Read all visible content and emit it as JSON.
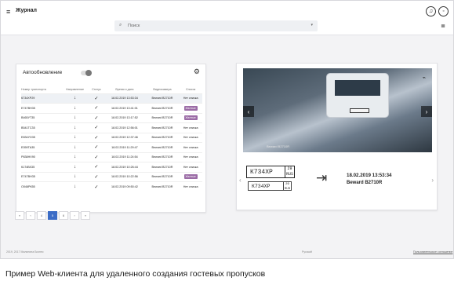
{
  "app": {
    "title": "Журнал",
    "menu_icon": "menu-icon",
    "notification_icon": "bell-icon",
    "user_icon": "user-icon"
  },
  "search": {
    "placeholder": "Поиск"
  },
  "journal": {
    "autoupdate": "Автообновление",
    "headers": [
      "Номер транспорта",
      "Направление",
      "Статус",
      "Время и дата",
      "Видеокамера",
      "Список"
    ],
    "rows": [
      {
        "plate": "К734ХР29",
        "time": "18.02.2019 13:53:34",
        "camera": "Beward B2710R",
        "list": "Нет списка",
        "badge": false
      },
      {
        "plate": "Е747ВН35",
        "time": "18.02.2019 13:41:01",
        "camera": "Beward B2710R",
        "list": "Желтые",
        "badge": true
      },
      {
        "plate": "В465УТ35",
        "time": "18.02.2019 13:17:52",
        "camera": "Beward B2710R",
        "list": "Желтые",
        "badge": true
      },
      {
        "plate": "В541ТС35",
        "time": "18.02.2019 12:56:01",
        "camera": "Beward B2710R",
        "list": "Нет списка",
        "badge": false
      },
      {
        "plate": "Е834УО35",
        "time": "18.02.2019 12:37:46",
        "camera": "Beward B2710R",
        "list": "Нет списка",
        "badge": false
      },
      {
        "plate": "Е059ТА35",
        "time": "18.02.2019 11:29:47",
        "camera": "Beward B2710R",
        "list": "Нет списка",
        "badge": false
      },
      {
        "plate": "Р838НХ90",
        "time": "18.02.2019 11:24:54",
        "camera": "Beward B2710R",
        "list": "Нет списка",
        "badge": false
      },
      {
        "plate": "К174ВХ35",
        "time": "18.02.2019 10:26:44",
        "camera": "Beward B2710R",
        "list": "Нет списка",
        "badge": false
      },
      {
        "plate": "Е747ВН35",
        "time": "18.02.2019 10:22:56",
        "camera": "Beward B2710R",
        "list": "Желтые",
        "badge": true
      },
      {
        "plate": "О046РК55",
        "time": "18.02.2019 09:50:42",
        "camera": "Beward B2710R",
        "list": "Нет списка",
        "badge": false
      }
    ],
    "pagination": [
      "«",
      "‹",
      "4",
      "5",
      "6",
      "›",
      "»"
    ],
    "active_page": "5"
  },
  "detail": {
    "plate_main": "К734ХР",
    "plate_region": "29",
    "plate_country": "RUS",
    "camera_label": "Beward B2710R",
    "time": "18.02.2019 13:53:34",
    "camera": "Beward B2710R"
  },
  "footer": {
    "left": "2019, 2017 Малинина Бизнес",
    "middle": "Русский",
    "right": "Пользовательское соглашение"
  },
  "caption": "Пример Web-клиента для удаленного создания гостевых пропусков"
}
